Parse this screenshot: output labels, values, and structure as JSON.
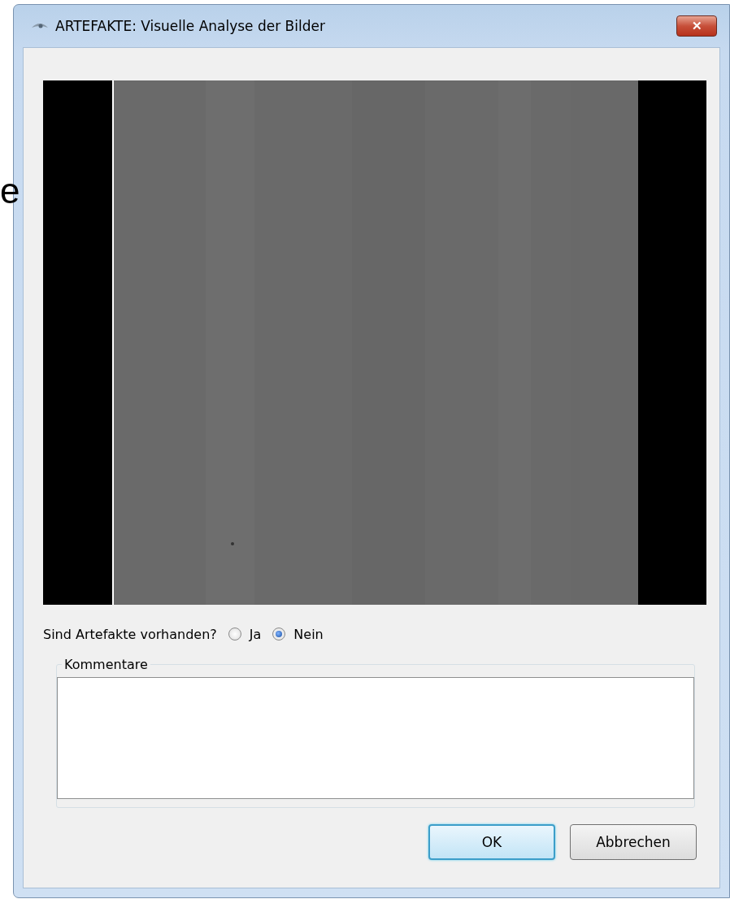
{
  "background_text": "e",
  "window": {
    "title": "ARTEFAKTE: Visuelle Analyse der Bilder",
    "close": "✕"
  },
  "question": {
    "label": "Sind Artefakte vorhanden?",
    "options": [
      {
        "label": "Ja",
        "selected": false
      },
      {
        "label": "Nein",
        "selected": true
      }
    ]
  },
  "comments": {
    "legend": "Kommentare"
  },
  "buttons": [
    {
      "label": "OK",
      "default": true
    },
    {
      "label": "Abbrechen",
      "default": false
    }
  ]
}
